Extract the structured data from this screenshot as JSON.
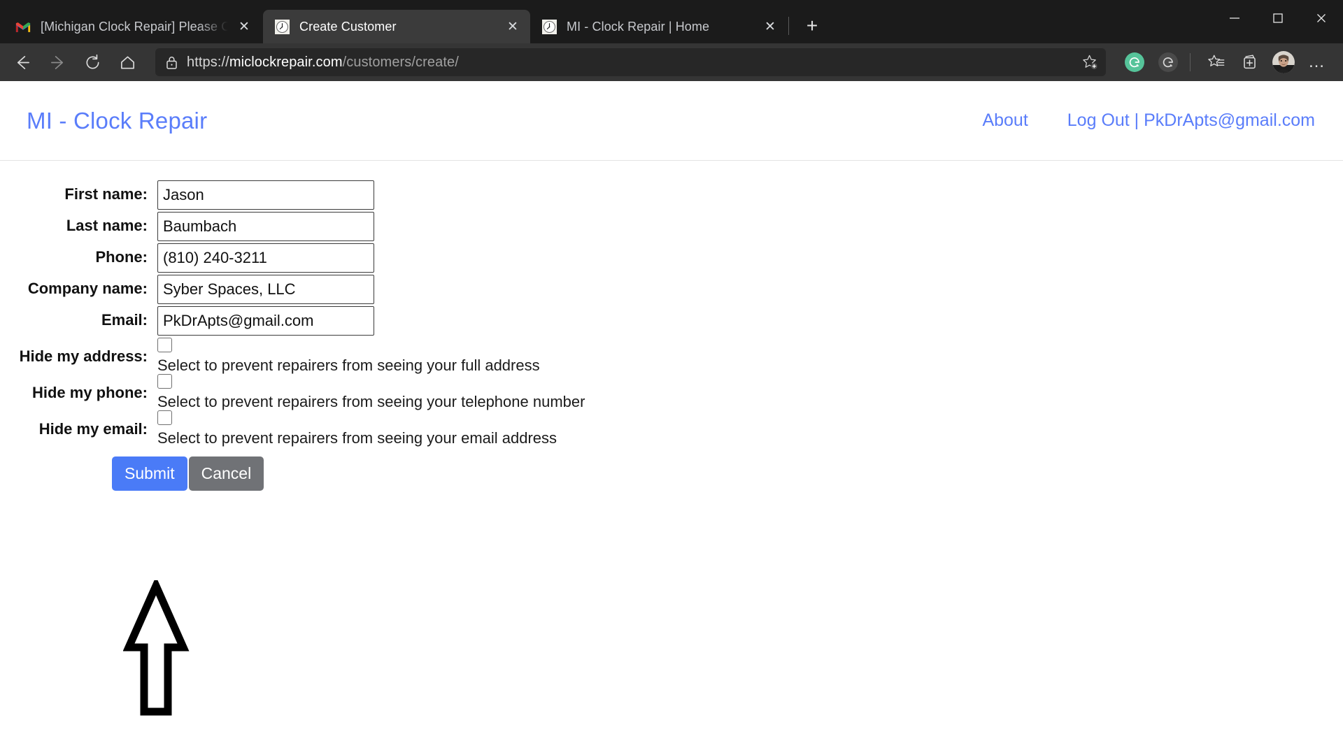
{
  "browser": {
    "tabs": [
      {
        "title": "[Michigan Clock Repair] Please C",
        "favicon": "gmail-icon",
        "active": false,
        "close_label": "✕"
      },
      {
        "title": "Create Customer",
        "favicon": "clock-icon",
        "active": true,
        "close_label": "✕"
      },
      {
        "title": "MI - Clock Repair | Home",
        "favicon": "clock-icon",
        "active": false,
        "close_label": "✕"
      }
    ],
    "new_tab_label": "+",
    "window_controls": {
      "minimize": "—",
      "maximize": "□",
      "close": "✕"
    },
    "toolbar": {
      "back": "back-arrow-icon",
      "forward": "forward-arrow-icon",
      "refresh": "refresh-icon",
      "home": "home-icon",
      "lock": "lock-icon",
      "url_scheme": "https://",
      "url_host": "miclockrepair.com",
      "url_path": "/customers/create/",
      "url_full": "https://miclockrepair.com/customers/create/",
      "add_favorite": "star-plus-icon",
      "grammarly_primary": "G",
      "grammarly_secondary": "G",
      "favorites": "favorites-star-icon",
      "collections": "collections-icon",
      "profile": "avatar",
      "settings_more": "…"
    }
  },
  "site": {
    "brand": "MI - Clock Repair",
    "nav": [
      {
        "label": "About"
      },
      {
        "label": "Log Out | PkDrApts@gmail.com"
      }
    ]
  },
  "form": {
    "fields": [
      {
        "label": "First name:",
        "value": "Jason",
        "name": "first-name"
      },
      {
        "label": "Last name:",
        "value": "Baumbach",
        "name": "last-name"
      },
      {
        "label": "Phone:",
        "value": "(810) 240-3211",
        "name": "phone"
      },
      {
        "label": "Company name:",
        "value": "Syber Spaces, LLC",
        "name": "company-name"
      },
      {
        "label": "Email:",
        "value": "PkDrApts@gmail.com",
        "name": "email"
      }
    ],
    "checkboxes": [
      {
        "label": "Hide my address:",
        "help": "Select to prevent repairers from seeing your full address",
        "checked": false,
        "name": "hide-address"
      },
      {
        "label": "Hide my phone:",
        "help": "Select to prevent repairers from seeing your telephone number",
        "checked": false,
        "name": "hide-phone"
      },
      {
        "label": "Hide my email:",
        "help": "Select to prevent repairers from seeing your email address",
        "checked": false,
        "name": "hide-email"
      }
    ],
    "submit_label": "Submit",
    "cancel_label": "Cancel"
  },
  "annotation": {
    "type": "up-arrow",
    "points_to": "Submit",
    "color": "#000000"
  },
  "colors": {
    "accent_blue": "#4a7bf7",
    "link_blue": "#5a7dfa",
    "cancel_gray": "#707276",
    "chrome_dark": "#1b1b1b",
    "toolbar_dark": "#353535",
    "grammarly_green": "#56c49a"
  }
}
